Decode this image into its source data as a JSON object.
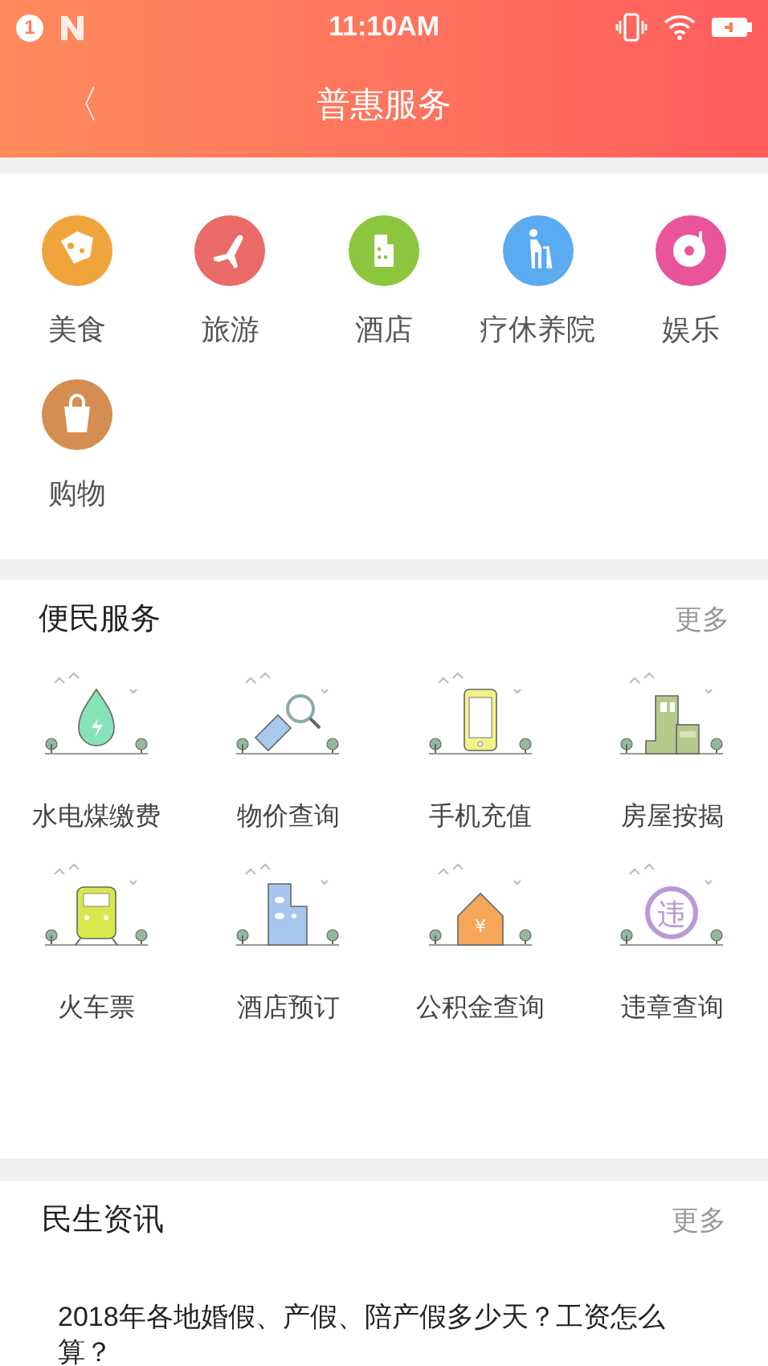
{
  "status_bar": {
    "notification_count": "1",
    "time": "11:10AM"
  },
  "header": {
    "back": "〈",
    "title": "普惠服务"
  },
  "categories": [
    {
      "label": "美食",
      "color": "#f0a53c"
    },
    {
      "label": "旅游",
      "color": "#ea6a68"
    },
    {
      "label": "酒店",
      "color": "#8cc63e"
    },
    {
      "label": "疗休养院",
      "color": "#5aabf0"
    },
    {
      "label": "娱乐",
      "color": "#e8559a"
    },
    {
      "label": "购物",
      "color": "#d48e52"
    }
  ],
  "services": {
    "title": "便民服务",
    "more": "更多",
    "items": [
      {
        "label": "水电煤缴费"
      },
      {
        "label": "物价查询"
      },
      {
        "label": "手机充值"
      },
      {
        "label": "房屋按揭"
      },
      {
        "label": "火车票"
      },
      {
        "label": "酒店预订"
      },
      {
        "label": "公积金查询",
        "icon_text": "¥"
      },
      {
        "label": "违章查询",
        "icon_text": "违"
      }
    ]
  },
  "news": {
    "title": "民生资讯",
    "more": "更多",
    "items": [
      {
        "headline": "2018年各地婚假、产假、陪产假多少天？工资怎么算？"
      }
    ]
  }
}
